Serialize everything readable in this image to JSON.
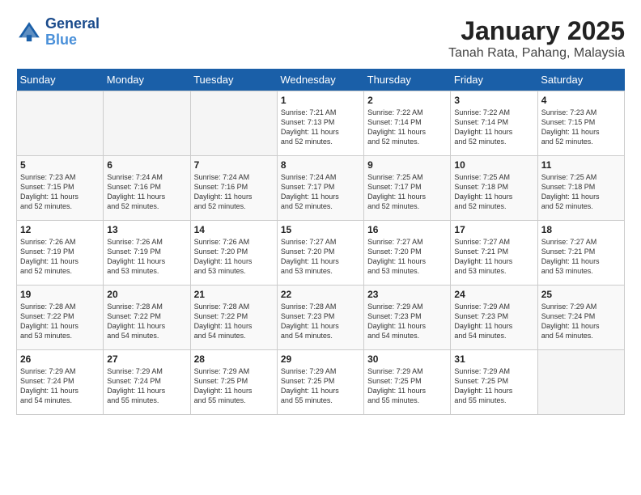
{
  "header": {
    "logo_line1": "General",
    "logo_line2": "Blue",
    "month_year": "January 2025",
    "location": "Tanah Rata, Pahang, Malaysia"
  },
  "weekdays": [
    "Sunday",
    "Monday",
    "Tuesday",
    "Wednesday",
    "Thursday",
    "Friday",
    "Saturday"
  ],
  "weeks": [
    [
      {
        "day": "",
        "info": ""
      },
      {
        "day": "",
        "info": ""
      },
      {
        "day": "",
        "info": ""
      },
      {
        "day": "1",
        "info": "Sunrise: 7:21 AM\nSunset: 7:13 PM\nDaylight: 11 hours\nand 52 minutes."
      },
      {
        "day": "2",
        "info": "Sunrise: 7:22 AM\nSunset: 7:14 PM\nDaylight: 11 hours\nand 52 minutes."
      },
      {
        "day": "3",
        "info": "Sunrise: 7:22 AM\nSunset: 7:14 PM\nDaylight: 11 hours\nand 52 minutes."
      },
      {
        "day": "4",
        "info": "Sunrise: 7:23 AM\nSunset: 7:15 PM\nDaylight: 11 hours\nand 52 minutes."
      }
    ],
    [
      {
        "day": "5",
        "info": "Sunrise: 7:23 AM\nSunset: 7:15 PM\nDaylight: 11 hours\nand 52 minutes."
      },
      {
        "day": "6",
        "info": "Sunrise: 7:24 AM\nSunset: 7:16 PM\nDaylight: 11 hours\nand 52 minutes."
      },
      {
        "day": "7",
        "info": "Sunrise: 7:24 AM\nSunset: 7:16 PM\nDaylight: 11 hours\nand 52 minutes."
      },
      {
        "day": "8",
        "info": "Sunrise: 7:24 AM\nSunset: 7:17 PM\nDaylight: 11 hours\nand 52 minutes."
      },
      {
        "day": "9",
        "info": "Sunrise: 7:25 AM\nSunset: 7:17 PM\nDaylight: 11 hours\nand 52 minutes."
      },
      {
        "day": "10",
        "info": "Sunrise: 7:25 AM\nSunset: 7:18 PM\nDaylight: 11 hours\nand 52 minutes."
      },
      {
        "day": "11",
        "info": "Sunrise: 7:25 AM\nSunset: 7:18 PM\nDaylight: 11 hours\nand 52 minutes."
      }
    ],
    [
      {
        "day": "12",
        "info": "Sunrise: 7:26 AM\nSunset: 7:19 PM\nDaylight: 11 hours\nand 52 minutes."
      },
      {
        "day": "13",
        "info": "Sunrise: 7:26 AM\nSunset: 7:19 PM\nDaylight: 11 hours\nand 53 minutes."
      },
      {
        "day": "14",
        "info": "Sunrise: 7:26 AM\nSunset: 7:20 PM\nDaylight: 11 hours\nand 53 minutes."
      },
      {
        "day": "15",
        "info": "Sunrise: 7:27 AM\nSunset: 7:20 PM\nDaylight: 11 hours\nand 53 minutes."
      },
      {
        "day": "16",
        "info": "Sunrise: 7:27 AM\nSunset: 7:20 PM\nDaylight: 11 hours\nand 53 minutes."
      },
      {
        "day": "17",
        "info": "Sunrise: 7:27 AM\nSunset: 7:21 PM\nDaylight: 11 hours\nand 53 minutes."
      },
      {
        "day": "18",
        "info": "Sunrise: 7:27 AM\nSunset: 7:21 PM\nDaylight: 11 hours\nand 53 minutes."
      }
    ],
    [
      {
        "day": "19",
        "info": "Sunrise: 7:28 AM\nSunset: 7:22 PM\nDaylight: 11 hours\nand 53 minutes."
      },
      {
        "day": "20",
        "info": "Sunrise: 7:28 AM\nSunset: 7:22 PM\nDaylight: 11 hours\nand 54 minutes."
      },
      {
        "day": "21",
        "info": "Sunrise: 7:28 AM\nSunset: 7:22 PM\nDaylight: 11 hours\nand 54 minutes."
      },
      {
        "day": "22",
        "info": "Sunrise: 7:28 AM\nSunset: 7:23 PM\nDaylight: 11 hours\nand 54 minutes."
      },
      {
        "day": "23",
        "info": "Sunrise: 7:29 AM\nSunset: 7:23 PM\nDaylight: 11 hours\nand 54 minutes."
      },
      {
        "day": "24",
        "info": "Sunrise: 7:29 AM\nSunset: 7:23 PM\nDaylight: 11 hours\nand 54 minutes."
      },
      {
        "day": "25",
        "info": "Sunrise: 7:29 AM\nSunset: 7:24 PM\nDaylight: 11 hours\nand 54 minutes."
      }
    ],
    [
      {
        "day": "26",
        "info": "Sunrise: 7:29 AM\nSunset: 7:24 PM\nDaylight: 11 hours\nand 54 minutes."
      },
      {
        "day": "27",
        "info": "Sunrise: 7:29 AM\nSunset: 7:24 PM\nDaylight: 11 hours\nand 55 minutes."
      },
      {
        "day": "28",
        "info": "Sunrise: 7:29 AM\nSunset: 7:25 PM\nDaylight: 11 hours\nand 55 minutes."
      },
      {
        "day": "29",
        "info": "Sunrise: 7:29 AM\nSunset: 7:25 PM\nDaylight: 11 hours\nand 55 minutes."
      },
      {
        "day": "30",
        "info": "Sunrise: 7:29 AM\nSunset: 7:25 PM\nDaylight: 11 hours\nand 55 minutes."
      },
      {
        "day": "31",
        "info": "Sunrise: 7:29 AM\nSunset: 7:25 PM\nDaylight: 11 hours\nand 55 minutes."
      },
      {
        "day": "",
        "info": ""
      }
    ]
  ]
}
